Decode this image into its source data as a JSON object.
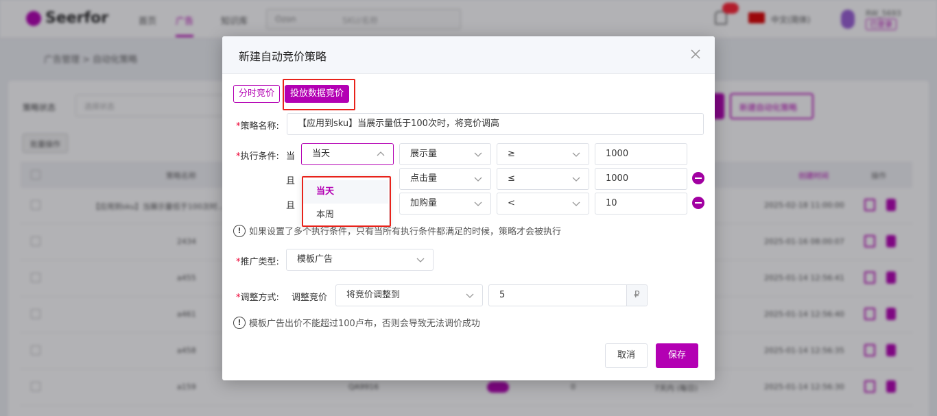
{
  "background": {
    "logo": "Seerfor",
    "nav": [
      "首页",
      "广告",
      "知识库"
    ],
    "search": {
      "select": "Ozon",
      "placeholder": "SKU/名称"
    },
    "language": "中文(简体)",
    "user": {
      "name": "RW_5693",
      "badge": "已登录"
    },
    "breadcrumb": "广告管理 > 自动化策略",
    "filter_label": "策略状态",
    "filter_select": "选择状态",
    "action_button": "新建自动化策略",
    "small_button": "批量操作",
    "table": {
      "headers": [
        "策略名称",
        "创建时间",
        "操作"
      ],
      "rows": [
        {
          "name": "【应用到sku】当展示量低于100次时...",
          "time": "2025-02-18 11:00:00"
        },
        {
          "name": "2434",
          "time": "2025-01-16 08:00:07"
        },
        {
          "name": "a455",
          "time": "2025-01-14 12:56:41"
        },
        {
          "name": "a461",
          "time": "2025-01-14 12:56:40"
        },
        {
          "name": "a458",
          "time": "2025-01-14 12:56:35"
        },
        {
          "name": "a159",
          "time": "2025-01-14 12:56:30",
          "sku": "QA9916",
          "count": "0",
          "range": "7天内 (每日)"
        }
      ]
    }
  },
  "modal": {
    "title": "新建自动竞价策略",
    "tabs": [
      "分时竞价",
      "投放数据竞价"
    ],
    "strategy_name": {
      "label": "策略名称:",
      "value": "【应用到sku】当展示量低于100次时，将竞价调高"
    },
    "conditions": {
      "label": "执行条件:",
      "when": "当",
      "and": "且",
      "rows": [
        {
          "period": "当天",
          "metric": "展示量",
          "operator": "≥",
          "value": "1000"
        },
        {
          "metric": "点击量",
          "operator": "≤",
          "value": "1000"
        },
        {
          "metric": "加购量",
          "operator": "<",
          "value": "10"
        }
      ],
      "period_options": [
        "当天",
        "本周"
      ],
      "note": "如果设置了多个执行条件，只有当所有执行条件都满足的时候，策略才会被执行"
    },
    "promo_type": {
      "label": "推广类型:",
      "value": "模板广告"
    },
    "adjust": {
      "label": "调整方式:",
      "sub_label": "调整竞价",
      "method": "将竞价调整到",
      "value": "5",
      "unit": "₽",
      "note": "模板广告出价不能超过100卢布，否则会导致无法调价成功"
    },
    "buttons": {
      "cancel": "取消",
      "save": "保存"
    }
  }
}
